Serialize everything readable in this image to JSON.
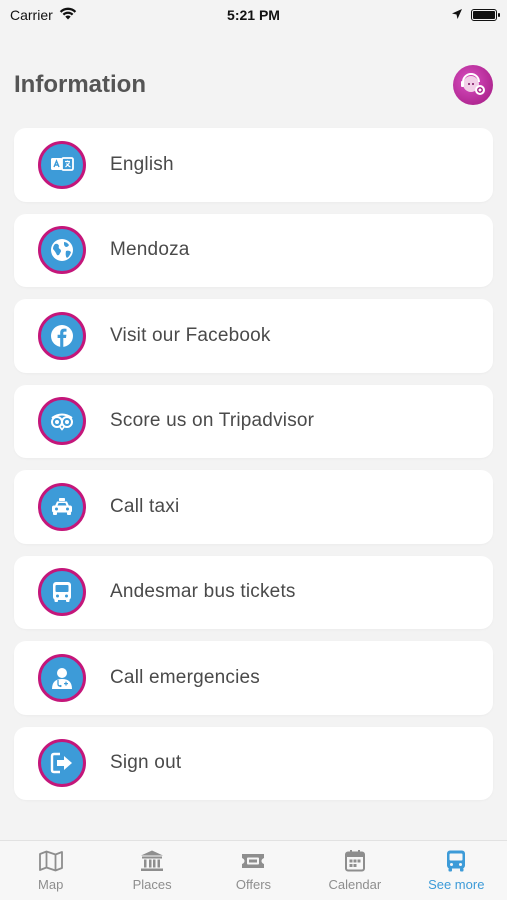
{
  "status_bar": {
    "carrier": "Carrier",
    "time": "5:21 PM"
  },
  "header": {
    "title": "Information"
  },
  "colors": {
    "icon_bg": "#3d9bd8",
    "icon_ring": "#c4167a",
    "active_tab": "#3d9bd8",
    "inactive_tab": "#8e8e8e"
  },
  "items": [
    {
      "label": "English",
      "icon": "translate-icon"
    },
    {
      "label": "Mendoza",
      "icon": "globe-icon"
    },
    {
      "label": "Visit our Facebook",
      "icon": "facebook-icon"
    },
    {
      "label": "Score us on Tripadvisor",
      "icon": "tripadvisor-icon"
    },
    {
      "label": "Call taxi",
      "icon": "taxi-icon"
    },
    {
      "label": "Andesmar bus tickets",
      "icon": "bus-icon"
    },
    {
      "label": "Call emergencies",
      "icon": "doctor-icon"
    },
    {
      "label": "Sign out",
      "icon": "sign-out-icon"
    }
  ],
  "tabs": [
    {
      "label": "Map",
      "icon": "map-icon",
      "active": false
    },
    {
      "label": "Places",
      "icon": "museum-icon",
      "active": false
    },
    {
      "label": "Offers",
      "icon": "ticket-icon",
      "active": false
    },
    {
      "label": "Calendar",
      "icon": "calendar-icon",
      "active": false
    },
    {
      "label": "See more",
      "icon": "bus-icon",
      "active": true
    }
  ]
}
